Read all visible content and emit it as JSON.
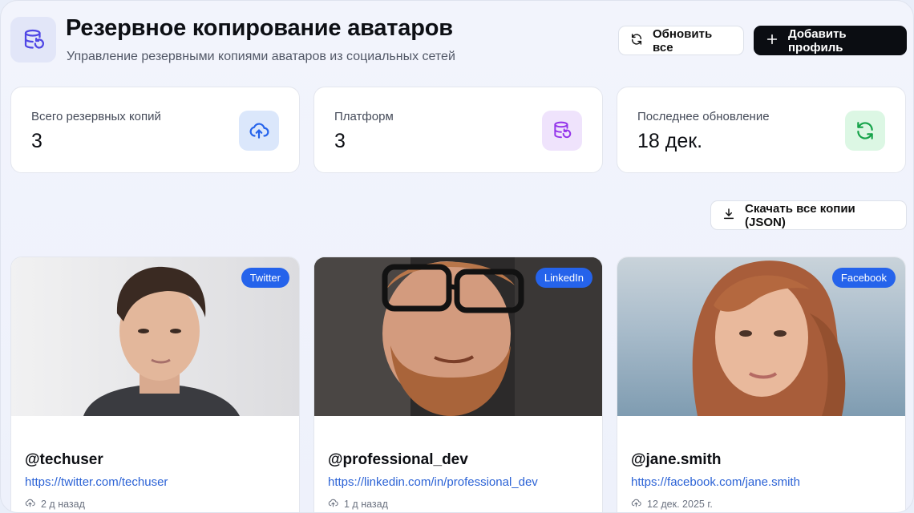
{
  "header": {
    "title": "Резервное копирование аватаров",
    "subtitle": "Управление резервными копиями аватаров из социальных сетей",
    "icon": "database-restore-icon",
    "refresh_label": "Обновить все",
    "add_label": "Добавить профиль"
  },
  "stats": [
    {
      "label": "Всего резервных копий",
      "value": "3",
      "icon": "cloud-upload-icon",
      "color": "#2563eb"
    },
    {
      "label": "Платформ",
      "value": "3",
      "icon": "database-restore-icon",
      "color": "#9333ea"
    },
    {
      "label": "Последнее обновление",
      "value": "18 дек.",
      "icon": "refresh-icon",
      "color": "#16a34a"
    }
  ],
  "download_label": "Скачать все копии (JSON)",
  "profiles": [
    {
      "platform": "Twitter",
      "handle": "@techuser",
      "url": "https://twitter.com/techuser",
      "time": "2 д назад"
    },
    {
      "platform": "LinkedIn",
      "handle": "@professional_dev",
      "url": "https://linkedin.com/in/professional_dev",
      "time": "1 д назад"
    },
    {
      "platform": "Facebook",
      "handle": "@jane.smith",
      "url": "https://facebook.com/jane.smith",
      "time": "12 дек. 2025 г."
    }
  ],
  "colors": {
    "accent": "#2563eb",
    "primary_button": "#0b0d12",
    "badge": "#2563eb"
  }
}
